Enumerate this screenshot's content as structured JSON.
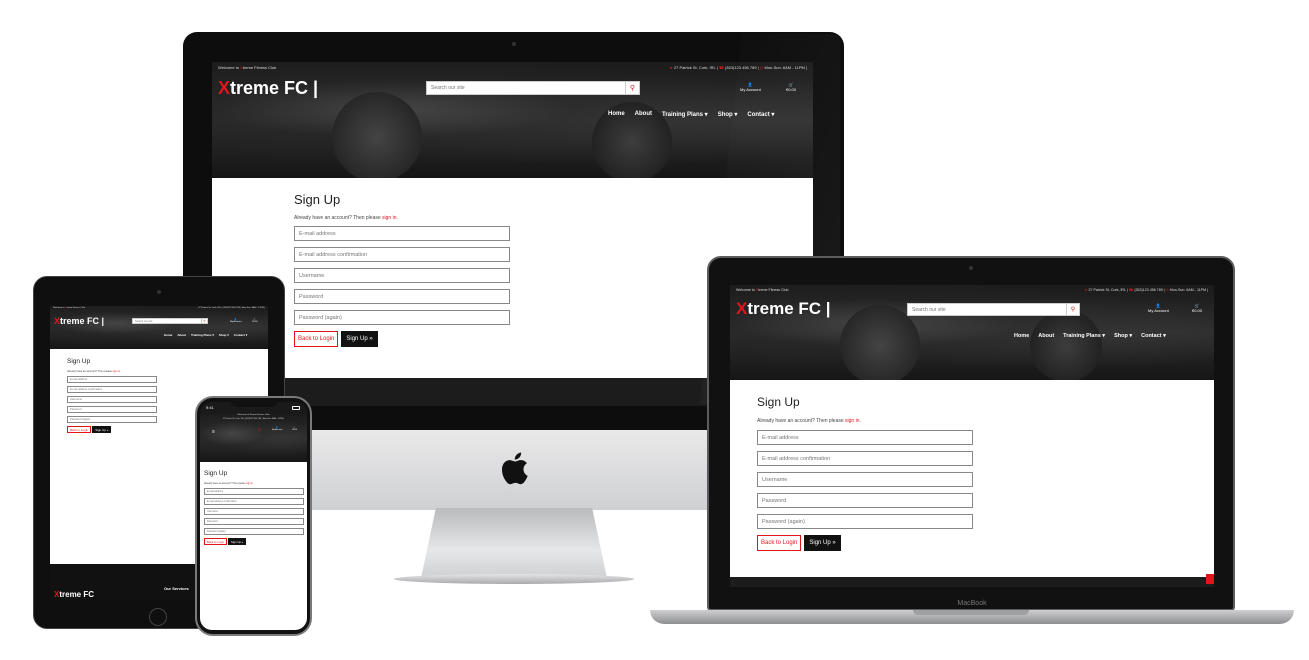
{
  "site": {
    "welcome_prefix": "Welcome to ",
    "welcome_x": "X",
    "welcome_suffix": "treme Fitness Club",
    "address": "27 Patrick St, Cork, IRL |",
    "phone": "(353)123 456 789 |",
    "hours": "Mon-Sun: 6AM - 11PM |",
    "logo_x": "X",
    "logo_rest": "treme FC |",
    "search_placeholder": "Search our site",
    "account_label": "My Account",
    "cart_total": "€0.00",
    "nav": [
      "Home",
      "About",
      "Training Plans ▾",
      "Shop ▾",
      "Contact ▾"
    ],
    "phone_welcome": "Welcome to Xtreme Fitness Club",
    "footer_logo_x": "X",
    "footer_logo_rest": "treme FC",
    "footer_services": "Our Services",
    "phone_time": "9:41"
  },
  "signup": {
    "title": "Sign Up",
    "note_prefix": "Already have an account? Then please ",
    "note_link": "sign in",
    "note_suffix": ".",
    "fields": [
      "E-mail address",
      "E-mail address confirmation",
      "Username",
      "Password",
      "Password (again)"
    ],
    "back_label": "Back to Login",
    "submit_label": "Sign Up »"
  },
  "devices": {
    "laptop_label": "MacBook"
  },
  "colors": {
    "accent": "#e0161b",
    "dark": "#111111"
  }
}
